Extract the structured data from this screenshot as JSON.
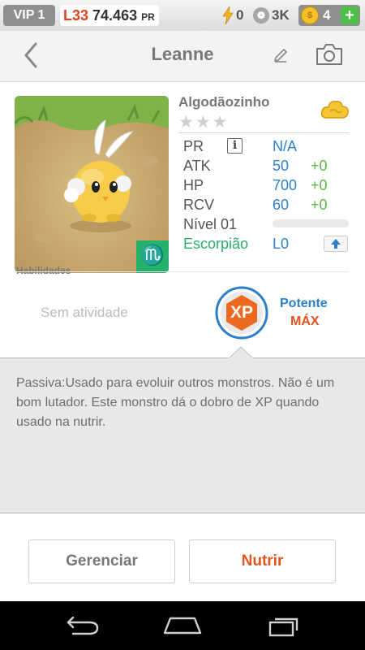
{
  "topbar": {
    "vip": "VIP 1",
    "level": "L33",
    "pr_value": "74.463",
    "pr_suffix": "PR",
    "energy": "0",
    "paws": "3K",
    "coins": "4"
  },
  "header": {
    "title": "Leanne"
  },
  "monster": {
    "name": "Algodãozinho",
    "stars_total": 3,
    "stars_filled": 0,
    "stats": [
      {
        "label": "PR",
        "value": "N/A",
        "bonus": ""
      },
      {
        "label": "ATK",
        "value": "50",
        "bonus": "+0"
      },
      {
        "label": "HP",
        "value": "700",
        "bonus": "+0"
      },
      {
        "label": "RCV",
        "value": "60",
        "bonus": "+0"
      }
    ],
    "level_label": "Nível 01",
    "level_progress": 0,
    "sign_name": "Escorpião",
    "sign_level": "L0"
  },
  "abilities": {
    "heading": "Habilidades",
    "none_text": "Sem atividade",
    "badge_text": "XP",
    "potency_label": "Potente",
    "potency_value": "MÁX"
  },
  "description": "Passiva:Usado para evoluir outros monstros. Não é um bom lutador. Este monstro dá o dobro de XP quando usado na nutrir.",
  "buttons": {
    "manage": "Gerenciar",
    "nurture": "Nutrir"
  },
  "colors": {
    "accent_blue": "#2d7fc9",
    "accent_orange": "#e3541f",
    "bonus_green": "#56b845",
    "sign_green": "#27b06b"
  }
}
